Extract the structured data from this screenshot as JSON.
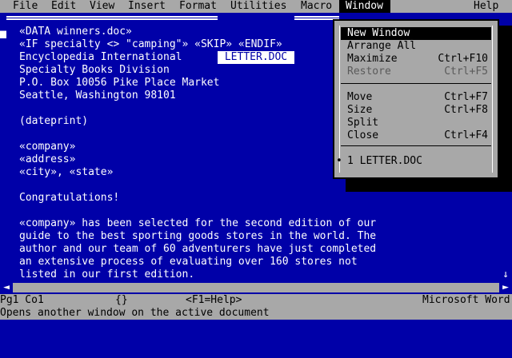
{
  "menubar": {
    "items": [
      "File",
      "Edit",
      "View",
      "Insert",
      "Format",
      "Utilities",
      "Macro",
      "Window",
      "Help"
    ]
  },
  "window": {
    "title": "LETTER.DOC"
  },
  "document": {
    "lines": [
      "«DATA winners.doc»",
      "«IF specialty <> \"camping\"» «SKIP» «ENDIF»",
      "Encyclopedia International",
      "Specialty Books Division",
      "P.O. Box 10056 Pike Place Market",
      "Seattle, Washington 98101",
      "",
      "(dateprint)",
      "",
      "«company»",
      "«address»",
      "«city», «state»",
      "",
      "Congratulations!",
      "",
      "«company» has been selected for the second edition of our",
      "guide to the best sporting goods stores in the world. The",
      "author and our team of 60 adventurers have just completed",
      "an extensive process of evaluating over 160 stores not",
      "listed in our first edition."
    ]
  },
  "window_menu": {
    "items": [
      {
        "label": "New Window",
        "hotkey": "N",
        "shortcut": ""
      },
      {
        "label": "Arrange All",
        "hotkey": "A",
        "shortcut": ""
      },
      {
        "label": "Maximize",
        "hotkey": "x",
        "shortcut": "Ctrl+F10"
      },
      {
        "label": "Restore",
        "hotkey": "R",
        "shortcut": "Ctrl+F5"
      },
      {
        "label": "Move",
        "hotkey": "M",
        "shortcut": "Ctrl+F7"
      },
      {
        "label": "Size",
        "hotkey": "S",
        "shortcut": "Ctrl+F8"
      },
      {
        "label": "Split",
        "hotkey": "t",
        "shortcut": ""
      },
      {
        "label": "Close",
        "hotkey": "C",
        "shortcut": "Ctrl+F4"
      },
      {
        "label": "1 LETTER.DOC",
        "hotkey": "1",
        "shortcut": ""
      }
    ],
    "bullet": "•"
  },
  "status": {
    "position": "Pg1 Co1",
    "indicator": "{}",
    "help": "<F1=Help>",
    "app": "Microsoft Word",
    "message": "Opens another window on the active document"
  },
  "scroll": {
    "left_arrow": "◄",
    "right_arrow": "►",
    "up_arrow": "↑",
    "down_arrow": "↓"
  },
  "colors": {
    "background": "#0000a8",
    "menu": "#a8a8a8",
    "text": "#ffffff"
  }
}
